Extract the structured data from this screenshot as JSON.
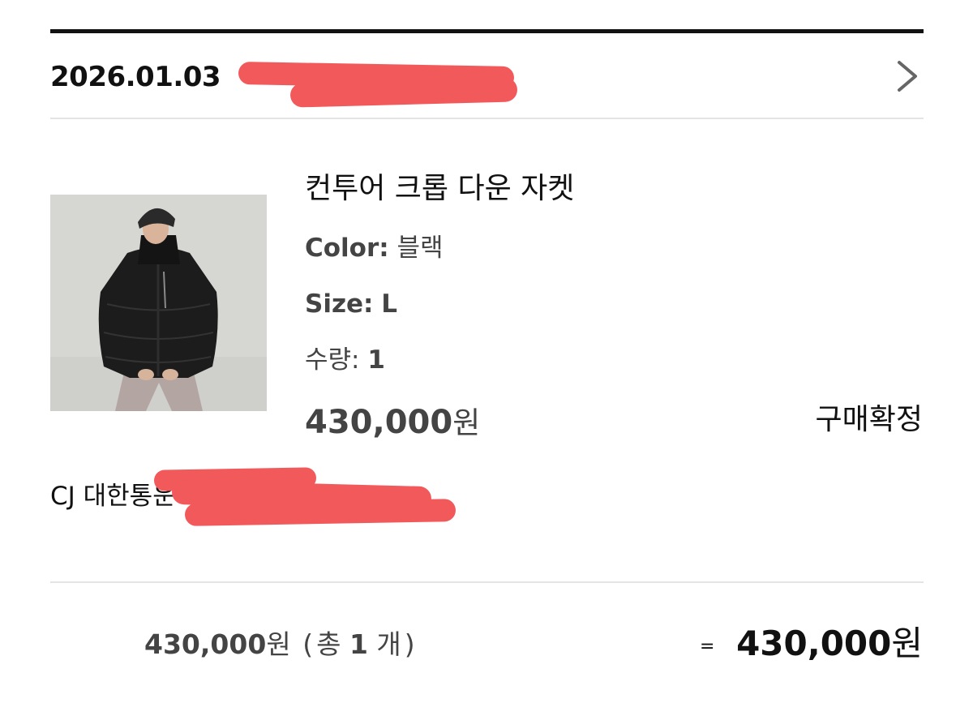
{
  "order": {
    "date": "2026.01.03"
  },
  "product": {
    "name": "컨투어 크롭 다운 자켓",
    "color_label": "Color:",
    "color_value": "블랙",
    "size_label": "Size:",
    "size_value": "L",
    "quantity_label": "수량:",
    "quantity_value": "1",
    "price_number": "430,000",
    "price_unit": "원",
    "status": "구매확정"
  },
  "shipping": {
    "courier": "CJ 대한통운"
  },
  "summary": {
    "subtotal_number": "430,000",
    "subtotal_unit": "원",
    "paren_open": "(",
    "count_prefix": "총",
    "count_number": "1",
    "count_suffix": "개",
    "paren_close": ")",
    "equals": "=",
    "total_number": "430,000",
    "total_unit": "원"
  },
  "colors": {
    "redaction": "#f2595b",
    "text_dark": "#111111",
    "text_gray": "#444444",
    "divider": "#e4e4e4"
  },
  "icons": {
    "header_arrow": "chevron-right-icon"
  }
}
